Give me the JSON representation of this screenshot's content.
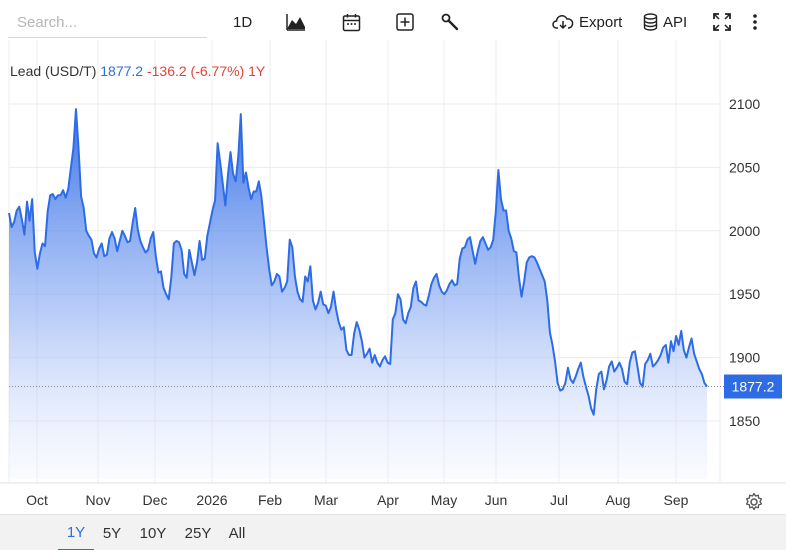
{
  "toolbar": {
    "search_placeholder": "Search...",
    "interval_label": "1D",
    "export_label": "Export",
    "api_label": "API"
  },
  "header": {
    "name": "Lead (USD/T)",
    "price": "1877.2",
    "change": "-136.2 (-6.77%)",
    "range": "1Y"
  },
  "current_price_label": "1877.2",
  "range_buttons": [
    {
      "label": "1Y",
      "active": true
    },
    {
      "label": "5Y",
      "active": false
    },
    {
      "label": "10Y",
      "active": false
    },
    {
      "label": "25Y",
      "active": false
    },
    {
      "label": "All",
      "active": false
    }
  ],
  "colors": {
    "line": "#2e6ce6",
    "negative": "#e0453a",
    "grid": "#ececec"
  },
  "chart_data": {
    "type": "area",
    "title": "Lead (USD/T)",
    "x_tick_labels": [
      "Oct",
      "Nov",
      "Dec",
      "2026",
      "Feb",
      "Mar",
      "Apr",
      "May",
      "Jun",
      "Jul",
      "Aug",
      "Sep"
    ],
    "y_tick_labels": [
      "1850",
      "1900",
      "1950",
      "2000",
      "2050",
      "2100"
    ],
    "ylim": [
      1800,
      2120
    ],
    "grid": true,
    "current_value": 1877.2,
    "series": [
      {
        "values": [
          2014,
          2003,
          2007,
          2016,
          2019,
          2009,
          1997,
          2023,
          2008,
          2025,
          1983,
          1970,
          1982,
          1990,
          1988,
          2015,
          2028,
          2029,
          2025,
          2028,
          2028,
          2032,
          2026,
          2033,
          2049,
          2065,
          2096,
          2065,
          2027,
          2018,
          2000,
          1996,
          1993,
          1982,
          1979,
          1986,
          1990,
          1980,
          1981,
          1994,
          1999,
          1994,
          1984,
          1992,
          2000,
          1996,
          1991,
          1992,
          2006,
          2018,
          2001,
          1992,
          1987,
          1983,
          1985,
          1994,
          1999,
          1980,
          1967,
          1968,
          1955,
          1950,
          1946,
          1963,
          1990,
          1992,
          1991,
          1985,
          1966,
          1963,
          1985,
          1975,
          1965,
          1975,
          1992,
          1977,
          1978,
          1996,
          2006,
          2016,
          2024,
          2069,
          2054,
          2037,
          2020,
          2044,
          2062,
          2045,
          2039,
          2058,
          2092,
          2038,
          2046,
          2034,
          2025,
          2031,
          2031,
          2039,
          2027,
          2007,
          1987,
          1970,
          1957,
          1960,
          1966,
          1964,
          1952,
          1955,
          1960,
          1993,
          1987,
          1964,
          1952,
          1946,
          1944,
          1964,
          1960,
          1972,
          1945,
          1938,
          1943,
          1952,
          1942,
          1941,
          1935,
          1940,
          1952,
          1938,
          1928,
          1922,
          1924,
          1906,
          1902,
          1902,
          1919,
          1928,
          1922,
          1913,
          1900,
          1903,
          1907,
          1896,
          1902,
          1896,
          1893,
          1898,
          1901,
          1896,
          1895,
          1930,
          1935,
          1950,
          1946,
          1930,
          1927,
          1935,
          1940,
          1955,
          1960,
          1945,
          1944,
          1942,
          1941,
          1949,
          1958,
          1963,
          1966,
          1957,
          1952,
          1950,
          1953,
          1958,
          1961,
          1957,
          1958,
          1978,
          1986,
          1987,
          1993,
          1995,
          1984,
          1974,
          1984,
          1992,
          1995,
          1990,
          1985,
          1987,
          1993,
          2015,
          2048,
          2025,
          2016,
          2016,
          2000,
          1994,
          1984,
          1983,
          1963,
          1948,
          1960,
          1975,
          1979,
          1980,
          1979,
          1975,
          1970,
          1965,
          1960,
          1945,
          1920,
          1910,
          1897,
          1880,
          1874,
          1875,
          1880,
          1892,
          1883,
          1880,
          1885,
          1891,
          1896,
          1885,
          1877,
          1870,
          1860,
          1855,
          1875,
          1887,
          1889,
          1875,
          1882,
          1893,
          1897,
          1889,
          1892,
          1896,
          1891,
          1881,
          1879,
          1896,
          1904,
          1905,
          1893,
          1880,
          1877,
          1895,
          1898,
          1903,
          1893,
          1895,
          1898,
          1902,
          1908,
          1910,
          1896,
          1913,
          1905,
          1917,
          1910,
          1921,
          1906,
          1900,
          1908,
          1915,
          1903,
          1897,
          1891,
          1887,
          1880,
          1877.2
        ]
      }
    ]
  }
}
